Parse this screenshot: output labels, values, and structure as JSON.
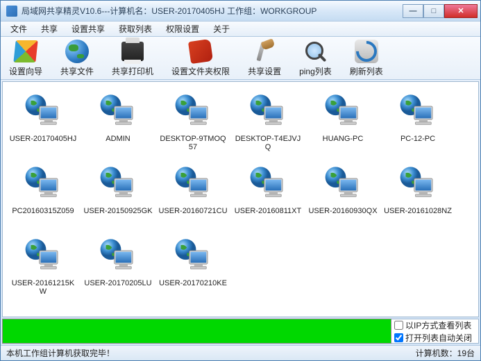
{
  "title": "局域网共享精灵V10.6---计算机名：USER-20170405HJ  工作组：WORKGROUP",
  "menu": [
    "文件",
    "共享",
    "设置共享",
    "获取列表",
    "权限设置",
    "关于"
  ],
  "toolbar": [
    {
      "label": "设置向导",
      "icon": "windows"
    },
    {
      "label": "共享文件",
      "icon": "globe"
    },
    {
      "label": "共享打印机",
      "icon": "printer"
    },
    {
      "label": "设置文件夹权限",
      "icon": "book"
    },
    {
      "label": "共享设置",
      "icon": "tools"
    },
    {
      "label": "ping列表",
      "icon": "magnify"
    },
    {
      "label": "刷新列表",
      "icon": "refresh"
    }
  ],
  "computers": [
    "USER-20170405HJ",
    "ADMIN",
    "DESKTOP-9TMOQ57",
    "DESKTOP-T4EJVJQ",
    "HUANG-PC",
    "PC-12-PC",
    "PC20160315Z059",
    "USER-20150925GK",
    "USER-20160721CU",
    "USER-20160811XT",
    "USER-20160930QX",
    "USER-20161028NZ",
    "USER-20161215KW",
    "USER-20170205LU",
    "USER-20170210KE"
  ],
  "options": {
    "ip_view": {
      "label": "以IP方式查看列表",
      "checked": false
    },
    "auto_close": {
      "label": "打开列表自动关闭",
      "checked": true
    }
  },
  "status": {
    "left": "本机工作组计算机获取完毕！",
    "right": "计算机数：19台"
  }
}
